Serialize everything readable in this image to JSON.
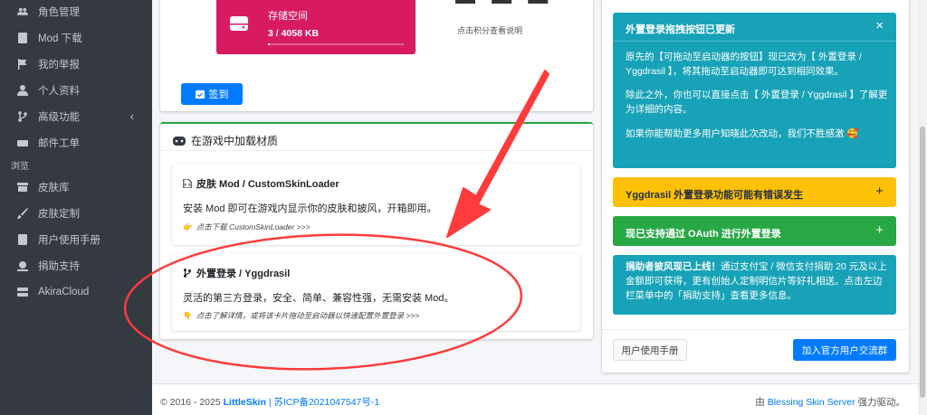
{
  "sidebar": {
    "items": [
      {
        "label": "角色管理",
        "icon": "users-icon"
      },
      {
        "label": "Mod 下载",
        "icon": "book-icon"
      },
      {
        "label": "我的举报",
        "icon": "flag-icon"
      },
      {
        "label": "个人资料",
        "icon": "user-icon"
      },
      {
        "label": "高级功能",
        "icon": "code-branch-icon",
        "chevron": "‹"
      },
      {
        "label": "邮件工单",
        "icon": "ticket-icon"
      }
    ],
    "section_header": "浏览",
    "browse_items": [
      {
        "label": "皮肤库",
        "icon": "archive-icon"
      },
      {
        "label": "皮肤定制",
        "icon": "brush-icon"
      },
      {
        "label": "用户使用手册",
        "icon": "book-icon"
      },
      {
        "label": "捐助支持",
        "icon": "donate-icon"
      },
      {
        "label": "AkiraCloud",
        "icon": "server-icon"
      }
    ]
  },
  "stats": {
    "storage_label": "存储空间",
    "storage_value": "3 / 4058 KB",
    "storage_fraction": 0.0007,
    "points_hint": "点击积分查看说明",
    "checkin_label": "签到"
  },
  "load_card": {
    "title": "在游戏中加载材质",
    "mod": {
      "title": "皮肤 Mod / CustomSkinLoader",
      "text": "安装 Mod 即可在游戏内显示你的皮肤和披风，开箱即用。",
      "hint": "点击下载 CustomSkinLoader >>>"
    },
    "yggdrasil": {
      "title": "外置登录 / Yggdrasil",
      "text": "灵活的第三方登录，安全、简单、兼容性强，无需安装 Mod。",
      "hint": "点击了解详情，或将该卡片拖动至启动器以快速配置外置登录 >>>"
    }
  },
  "announcements": {
    "a1": {
      "title": "外置登录拖拽按钮已更新",
      "close": "×",
      "p1": "原先的【可拖动至启动器的按钮】现已改为【 外置登录 / Yggdrasil 】，将其拖动至启动器即可达到相同效果。",
      "p2": "除此之外，你也可以直接点击【 外置登录 / Yggdrasil 】了解更为详细的内容。",
      "p3": "如果你能帮助更多用户知晓此次改动，我们不胜感激 🥰"
    },
    "a2": {
      "title": "Yggdrasil 外置登录功能可能有错误发生",
      "toggle": "+"
    },
    "a3": {
      "title": "现已支持通过 OAuth 进行外置登录",
      "toggle": "+"
    },
    "a4": {
      "bold": "捐助者披风现已上线！",
      "text": "通过支付宝 / 微信支付捐助 20 元及以上金额即可获得，更有创始人定制明信片等好礼相送。点击左边栏菜单中的「捐助支持」查看更多信息。"
    },
    "btn_manual": "用户使用手册",
    "btn_group": "加入官方用户交流群"
  },
  "footer": {
    "copyright": "© 2016 - 2025",
    "brand": "LittleSkin",
    "sep": "|",
    "icp": "苏ICP备2021047547号-1",
    "powered_prefix": "由",
    "powered_link": "Blessing Skin Server",
    "powered_suffix": "强力驱动。"
  },
  "colors": {
    "sidebar_bg": "#343a40",
    "storage_bg": "#d81b60",
    "primary": "#007bff",
    "info": "#17a2b8",
    "warning": "#ffc107",
    "success": "#28a745",
    "annotation": "#ff3b3b"
  }
}
